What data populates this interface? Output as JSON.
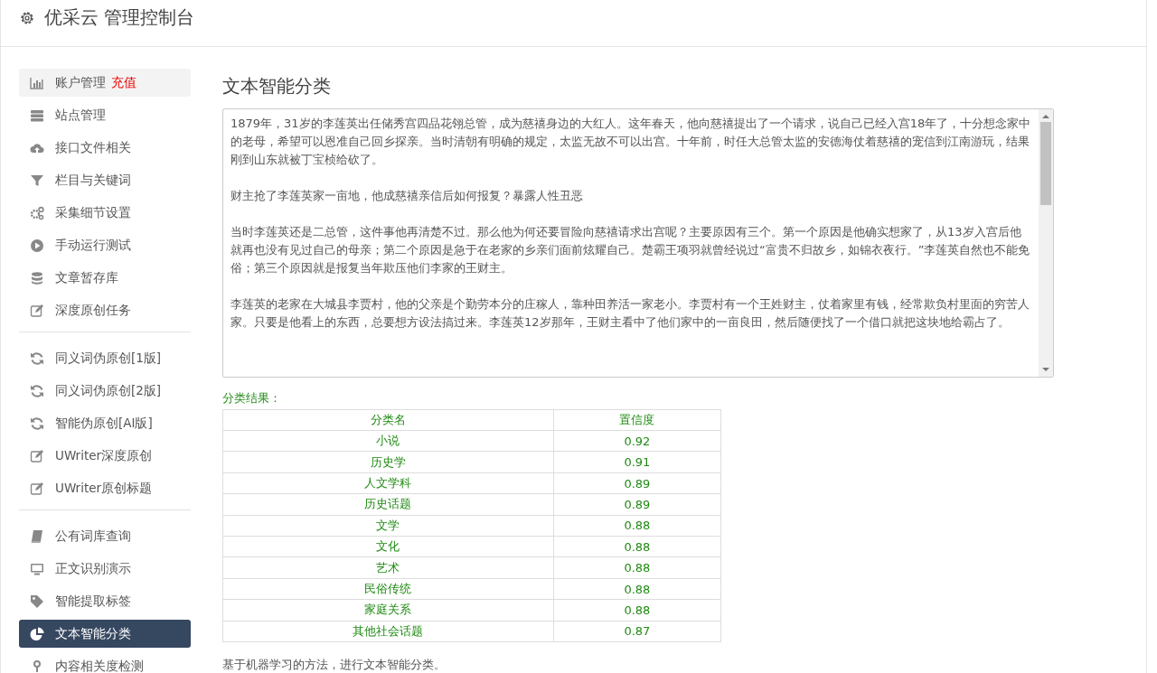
{
  "header": {
    "title": "优采云 管理控制台"
  },
  "sidebar": {
    "groups": [
      {
        "items": [
          {
            "label": "账户管理",
            "badge": "充值",
            "hovered": true,
            "selected": false
          },
          {
            "label": "站点管理",
            "hovered": false,
            "selected": false
          },
          {
            "label": "接口文件相关",
            "hovered": false,
            "selected": false
          },
          {
            "label": "栏目与关键词",
            "hovered": false,
            "selected": false
          },
          {
            "label": "采集细节设置",
            "hovered": false,
            "selected": false
          },
          {
            "label": "手动运行测试",
            "hovered": false,
            "selected": false
          },
          {
            "label": "文章暂存库",
            "hovered": false,
            "selected": false
          },
          {
            "label": "深度原创任务",
            "hovered": false,
            "selected": false
          }
        ]
      },
      {
        "items": [
          {
            "label": "同义词伪原创[1版]",
            "hovered": false,
            "selected": false
          },
          {
            "label": "同义词伪原创[2版]",
            "hovered": false,
            "selected": false
          },
          {
            "label": "智能伪原创[AI版]",
            "hovered": false,
            "selected": false
          },
          {
            "label": "UWriter深度原创",
            "hovered": false,
            "selected": false
          },
          {
            "label": "UWriter原创标题",
            "hovered": false,
            "selected": false
          }
        ]
      },
      {
        "items": [
          {
            "label": "公有词库查询",
            "hovered": false,
            "selected": false
          },
          {
            "label": "正文识别演示",
            "hovered": false,
            "selected": false
          },
          {
            "label": "智能提取标签",
            "hovered": false,
            "selected": false
          },
          {
            "label": "文本智能分类",
            "hovered": false,
            "selected": true
          },
          {
            "label": "内容相关度检测",
            "hovered": false,
            "selected": false
          }
        ]
      }
    ]
  },
  "main": {
    "title": "文本智能分类",
    "input_text": [
      "1879年，31岁的李莲英出任储秀宫四品花翎总管，成为慈禧身边的大红人。这年春天，他向慈禧提出了一个请求，说自己已经入宫18年了，十分想念家中的老母，希望可以恩准自己回乡探亲。当时清朝有明确的规定，太监无故不可以出宫。十年前，时任大总管太监的安德海仗着慈禧的宠信到江南游玩，结果刚到山东就被丁宝桢给砍了。",
      "财主抢了李莲英家一亩地，他成慈禧亲信后如何报复？暴露人性丑恶",
      "当时李莲英还是二总管，这件事他再清楚不过。那么他为何还要冒险向慈禧请求出宫呢？主要原因有三个。第一个原因是他确实想家了，从13岁入宫后他就再也没有见过自己的母亲；第二个原因是急于在老家的乡亲们面前炫耀自己。楚霸王项羽就曾经说过“富贵不归故乡，如锦衣夜行。”李莲英自然也不能免俗；第三个原因就是报复当年欺压他们李家的王财主。",
      "李莲英的老家在大城县李贾村，他的父亲是个勤劳本分的庄稼人，靠种田养活一家老小。李贾村有一个王姓财主，仗着家里有钱，经常欺负村里面的穷苦人家。只要是他看上的东西，总要想方设法搞过来。李莲英12岁那年，王财主看中了他们家中的一亩良田，然后随便找了一个借口就把这块地给霸占了。"
    ],
    "result_label": "分类结果：",
    "table": {
      "columns": [
        "分类名",
        "置信度"
      ],
      "rows": [
        [
          "小说",
          "0.92"
        ],
        [
          "历史学",
          "0.91"
        ],
        [
          "人文学科",
          "0.89"
        ],
        [
          "历史话题",
          "0.89"
        ],
        [
          "文学",
          "0.88"
        ],
        [
          "文化",
          "0.88"
        ],
        [
          "艺术",
          "0.88"
        ],
        [
          "民俗传统",
          "0.88"
        ],
        [
          "家庭关系",
          "0.88"
        ],
        [
          "其他社会话题",
          "0.87"
        ]
      ]
    },
    "note": "基于机器学习的方法，进行文本智能分类。"
  }
}
